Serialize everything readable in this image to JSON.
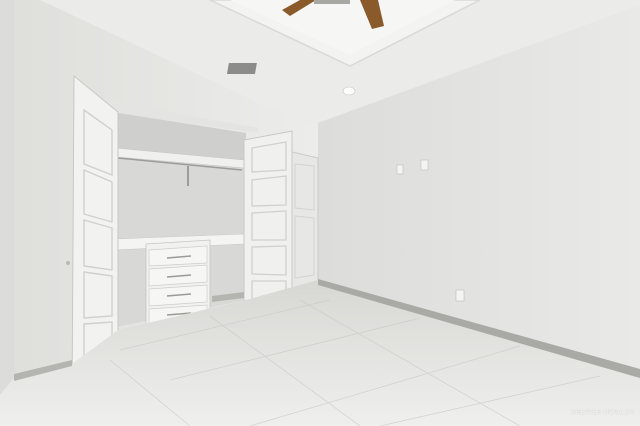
{
  "scene": {
    "subject": "empty-bedroom-with-open-closet",
    "colors": {
      "ceiling": "#ebebea",
      "tray_ceiling": "#f2f2f1",
      "right_wall": "#e6e6e4",
      "left_wall": "#eaeaea",
      "closet_interior": "#dcdcda",
      "door": "#f1f1ef",
      "floor": "#e3e2e0",
      "baseboard": "#a9a9a6",
      "fan_blade": "#8a5a2b"
    }
  },
  "watermark": {
    "text": "GREATER MCALLEN"
  }
}
